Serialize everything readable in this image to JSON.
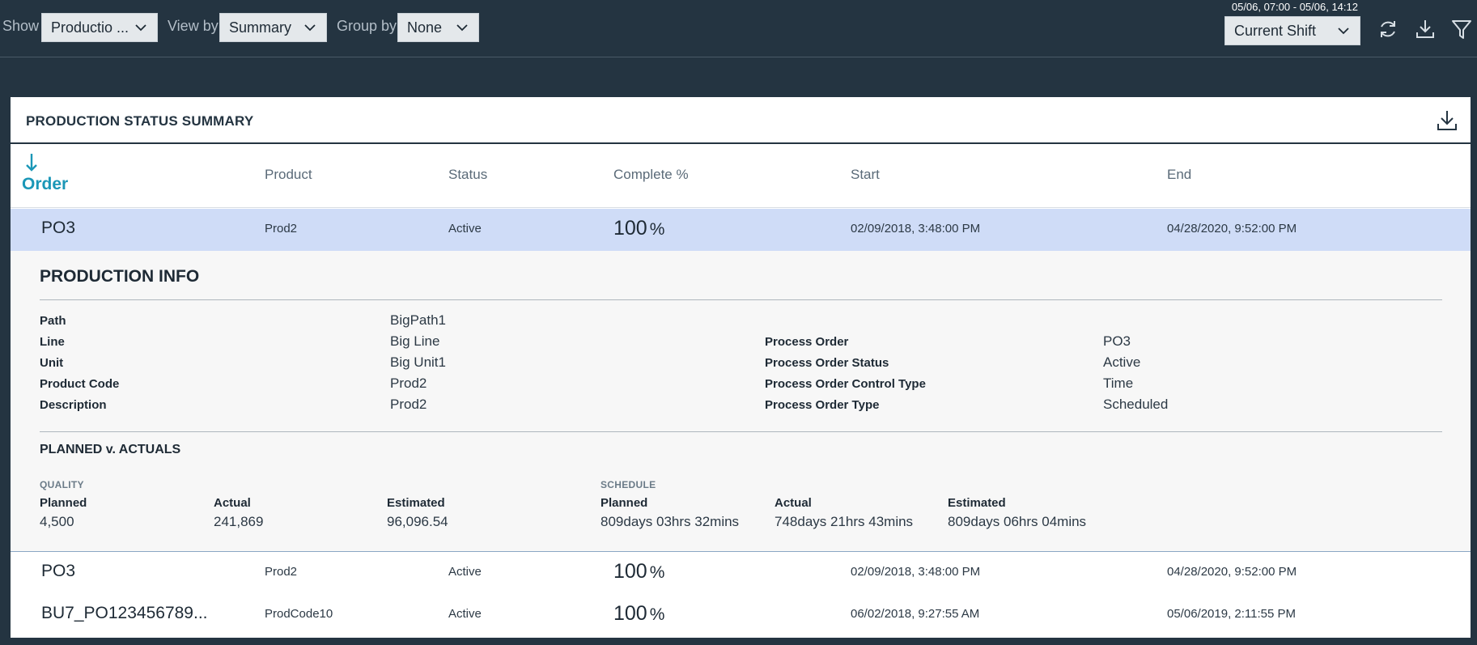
{
  "toolbar": {
    "show_label": "Show",
    "show_value": "Productio ...",
    "viewby_label": "View by",
    "viewby_value": "Summary",
    "groupby_label": "Group by",
    "groupby_value": "None",
    "time_range": "05/06, 07:00 - 05/06, 14:12",
    "shift_value": "Current Shift",
    "icons": [
      "refresh-icon",
      "download-icon",
      "filter-icon"
    ]
  },
  "card": {
    "title": "PRODUCTION STATUS SUMMARY",
    "columns": {
      "order": "Order",
      "product": "Product",
      "status": "Status",
      "complete": "Complete %",
      "start": "Start",
      "end": "End"
    },
    "rows": [
      {
        "order": "PO3",
        "product": "Prod2",
        "status": "Active",
        "complete": "100",
        "pct": "%",
        "start": "02/09/2018, 3:48:00 PM",
        "end": "04/28/2020, 9:52:00 PM"
      },
      {
        "order": "PO3",
        "product": "Prod2",
        "status": "Active",
        "complete": "100",
        "pct": "%",
        "start": "02/09/2018, 3:48:00 PM",
        "end": "04/28/2020, 9:52:00 PM"
      },
      {
        "order": "BU7_PO123456789...",
        "product": "ProdCode10",
        "status": "Active",
        "complete": "100",
        "pct": "%",
        "start": "06/02/2018, 9:27:55 AM",
        "end": "05/06/2019, 2:11:55 PM"
      }
    ]
  },
  "detail": {
    "title": "PRODUCTION INFO",
    "left": [
      {
        "k": "Path",
        "v": "BigPath1"
      },
      {
        "k": "Line",
        "v": "Big Line"
      },
      {
        "k": "Unit",
        "v": "Big Unit1"
      },
      {
        "k": "Product Code",
        "v": "Prod2"
      },
      {
        "k": "Description",
        "v": "Prod2"
      }
    ],
    "right": [
      {
        "k": "Process Order",
        "v": "PO3"
      },
      {
        "k": "Process Order Status",
        "v": "Active"
      },
      {
        "k": "Process Order Control Type",
        "v": "Time"
      },
      {
        "k": "Process Order Type",
        "v": "Scheduled"
      }
    ],
    "pva_title": "PLANNED v. ACTUALS",
    "quality": {
      "label": "QUALITY",
      "planned_k": "Planned",
      "planned_v": "4,500",
      "actual_k": "Actual",
      "actual_v": "241,869",
      "estimated_k": "Estimated",
      "estimated_v": "96,096.54"
    },
    "schedule": {
      "label": "SCHEDULE",
      "planned_k": "Planned",
      "planned_v": "809days 03hrs 32mins",
      "actual_k": "Actual",
      "actual_v": "748days 21hrs 43mins",
      "estimated_k": "Estimated",
      "estimated_v": "809days 06hrs 04mins"
    }
  }
}
